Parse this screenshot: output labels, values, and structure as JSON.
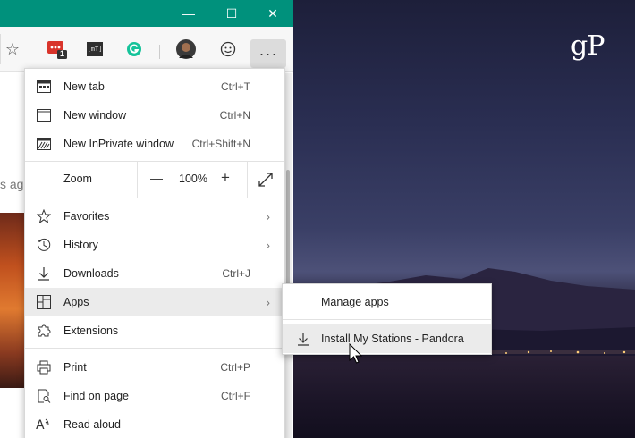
{
  "watermark": {
    "text": "gP"
  },
  "window": {
    "minimize_glyph": "—",
    "maximize_glyph": "☐",
    "close_glyph": "✕"
  },
  "toolbar": {
    "favorite_star": "☆",
    "badge_count": "1",
    "ext_label": "[mT]",
    "more_glyph": "···"
  },
  "page": {
    "partial_text": "s ago"
  },
  "menu": {
    "items": [
      {
        "label": "New tab",
        "shortcut": "Ctrl+T"
      },
      {
        "label": "New window",
        "shortcut": "Ctrl+N"
      },
      {
        "label": "New InPrivate window",
        "shortcut": "Ctrl+Shift+N"
      }
    ],
    "zoom": {
      "label": "Zoom",
      "minus": "—",
      "value": "100%",
      "plus": "+"
    },
    "items2": [
      {
        "label": "Favorites",
        "shortcut": ""
      },
      {
        "label": "History",
        "shortcut": ""
      },
      {
        "label": "Downloads",
        "shortcut": "Ctrl+J"
      },
      {
        "label": "Apps",
        "shortcut": ""
      },
      {
        "label": "Extensions",
        "shortcut": ""
      }
    ],
    "items3": [
      {
        "label": "Print",
        "shortcut": "Ctrl+P"
      },
      {
        "label": "Find on page",
        "shortcut": "Ctrl+F"
      },
      {
        "label": "Read aloud",
        "shortcut": ""
      }
    ],
    "chevron": "›"
  },
  "submenu": {
    "manage": "Manage apps",
    "install": "Install My Stations - Pandora"
  },
  "colors": {
    "titlebar": "#00917c",
    "highlight": "#ebebeb"
  }
}
